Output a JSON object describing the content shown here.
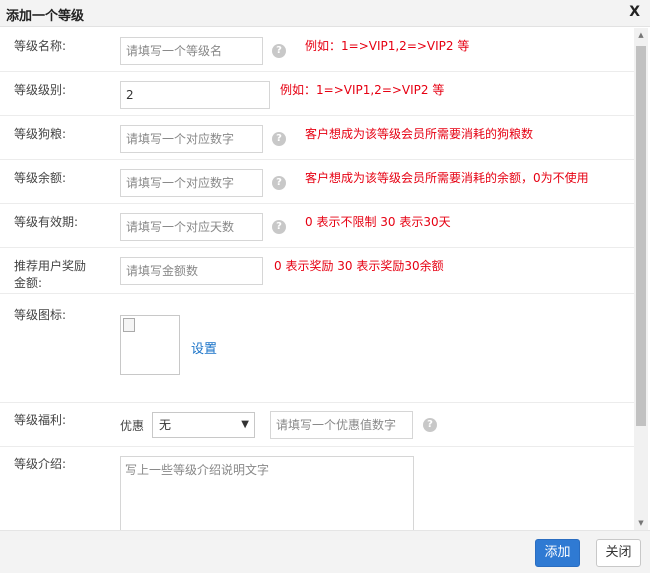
{
  "dialog": {
    "title": "添加一个等级",
    "close_label": "X"
  },
  "form": {
    "name": {
      "label": "等级名称:",
      "placeholder": "请填写一个等级名",
      "hint": "例如：1=>VIP1,2=>VIP2 等"
    },
    "level": {
      "label": "等级级别:",
      "value": "2",
      "hint": "例如：1=>VIP1,2=>VIP2 等"
    },
    "dog_food": {
      "label": "等级狗粮:",
      "placeholder": "请填写一个对应数字",
      "hint": "客户想成为该等级会员所需要消耗的狗粮数"
    },
    "balance": {
      "label": "等级余额:",
      "placeholder": "请填写一个对应数字",
      "hint": "客户想成为该等级会员所需要消耗的余额，0为不使用"
    },
    "validity": {
      "label": "等级有效期:",
      "placeholder": "请填写一个对应天数",
      "hint": "0 表示不限制 30 表示30天"
    },
    "referral": {
      "label_line1": "推荐用户奖励",
      "label_line2": "金额:",
      "placeholder": "请填写金额数",
      "hint": "0 表示奖励 30 表示奖励30余额"
    },
    "icon": {
      "label": "等级图标:",
      "set_link": "设置"
    },
    "benefit": {
      "label": "等级福利:",
      "sub_label": "优惠",
      "select_value": "无",
      "placeholder": "请填写一个优惠值数字"
    },
    "intro": {
      "label": "等级介绍:",
      "placeholder": "写上一些等级介绍说明文字"
    }
  },
  "footer": {
    "add_label": "添加",
    "close_label": "关闭"
  },
  "help_glyph": "?",
  "colors": {
    "hint": "#e60012",
    "primary": "#2f7ad3",
    "link": "#1a73c8"
  }
}
